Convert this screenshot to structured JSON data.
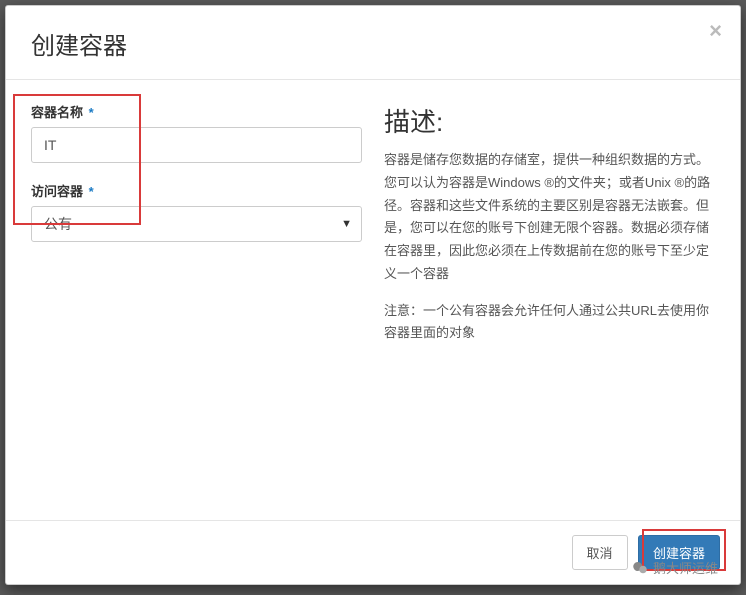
{
  "modal": {
    "title": "创建容器",
    "close_aria": "×"
  },
  "form": {
    "name": {
      "label": "容器名称",
      "required_mark": "*",
      "value": "IT"
    },
    "access": {
      "label": "访问容器",
      "required_mark": "*",
      "selected": "公有",
      "options": [
        "公有"
      ]
    }
  },
  "description": {
    "heading": "描述:",
    "paragraph1": "容器是储存您数据的存储室，提供一种组织数据的方式。您可以认为容器是Windows ®的文件夹；或者Unix ®的路径。容器和这些文件系统的主要区别是容器无法嵌套。但是，您可以在您的账号下创建无限个容器。数据必须存储在容器里，因此您必须在上传数据前在您的账号下至少定义一个容器",
    "paragraph2": "注意：一个公有容器会允许任何人通过公共URL去使用你容器里面的对象"
  },
  "footer": {
    "cancel": "取消",
    "submit": "创建容器"
  },
  "watermark": {
    "text": "鹅大师运维"
  }
}
